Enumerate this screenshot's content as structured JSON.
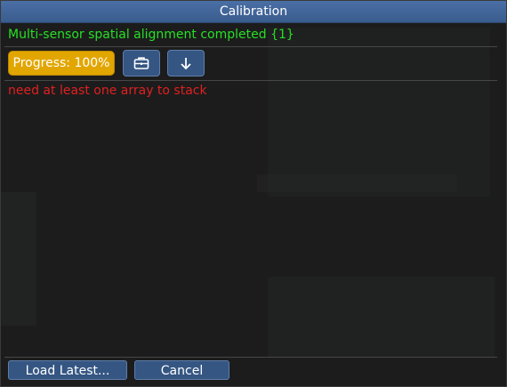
{
  "dialog": {
    "title": "Calibration",
    "status_message": "Multi-sensor spatial alignment completed {1}",
    "error_message": "need at least one array to stack"
  },
  "toolbar": {
    "progress_label": "Progress: 100%",
    "progress_value": 1.0,
    "toolbox_icon": "briefcase-icon",
    "download_icon": "arrow-down-icon"
  },
  "footer": {
    "load_latest_label": "Load Latest...",
    "cancel_label": "Cancel"
  },
  "colors": {
    "title_bar": "#4a6fa5",
    "status_text": "#26e026",
    "error_text": "#e02020",
    "progress_fill": "#e2a600",
    "button_fill": "#355683"
  }
}
